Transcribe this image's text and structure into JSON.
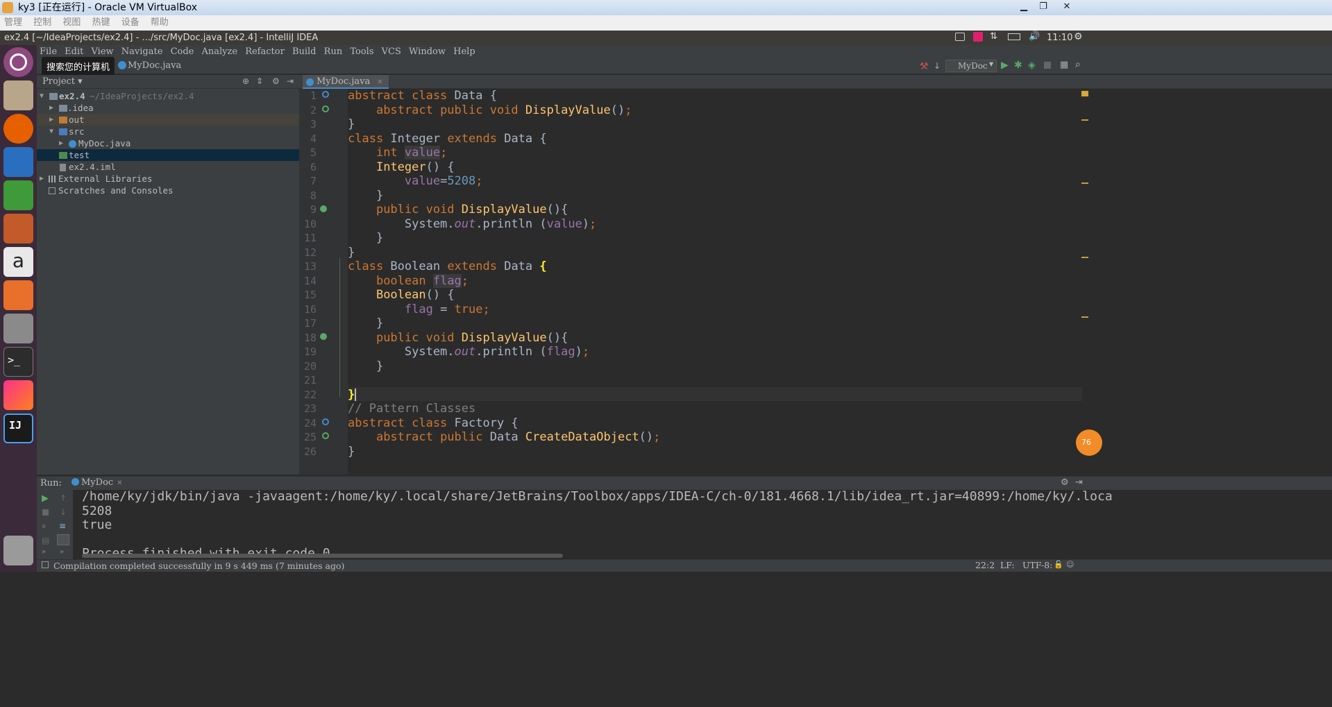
{
  "vbox": {
    "title": "ky3 [正在运行] - Oracle VM VirtualBox",
    "minimize": "▁",
    "restore": "❐",
    "close": "✕"
  },
  "vbox_menu": [
    "管理",
    "控制",
    "视图",
    "热键",
    "设备",
    "帮助"
  ],
  "ubuntu_bar": {
    "window_title": "ex2.4 [~/IdeaProjects/ex2.4] - .../src/MyDoc.java [ex2.4] - IntelliJ IDEA",
    "time": "11:10"
  },
  "launcher_tooltip": "搜索您的计算机",
  "ide_menu": [
    "File",
    "Edit",
    "View",
    "Navigate",
    "Code",
    "Analyze",
    "Refactor",
    "Build",
    "Run",
    "Tools",
    "VCS",
    "Window",
    "Help"
  ],
  "breadcrumb": "MyDoc.java",
  "run_config": "MyDoc",
  "project_panel": {
    "title": "Project"
  },
  "tree": [
    {
      "label": "ex2.4",
      "path": "~/IdeaProjects/ex2.4"
    },
    {
      "label": ".idea"
    },
    {
      "label": "out"
    },
    {
      "label": "src"
    },
    {
      "label": "MyDoc.java"
    },
    {
      "label": "test"
    },
    {
      "label": "ex2.4.iml"
    },
    {
      "label": "External Libraries"
    },
    {
      "label": "Scratches and Consoles"
    }
  ],
  "editor_tab": "MyDoc.java",
  "line_numbers": [
    "1",
    "2",
    "3",
    "4",
    "5",
    "6",
    "7",
    "8",
    "9",
    "10",
    "11",
    "12",
    "13",
    "14",
    "15",
    "16",
    "17",
    "18",
    "19",
    "20",
    "21",
    "22",
    "23",
    "24",
    "25",
    "26"
  ],
  "code": {
    "comment_line": "// Pattern Classes"
  },
  "run_panel": {
    "label": "Run:",
    "tab": "MyDoc"
  },
  "console_lines": [
    "/home/ky/jdk/bin/java -javaagent:/home/ky/.local/share/JetBrains/Toolbox/apps/IDEA-C/ch-0/181.4668.1/lib/idea_rt.jar=40899:/home/ky/.loca",
    "5208",
    "true",
    "",
    "Process finished with exit code 0"
  ],
  "status_bar": {
    "message": "Compilation completed successfully in 9 s 449 ms (7 minutes ago)",
    "position": "22:2",
    "line_sep": "LF:",
    "encoding": "UTF-8:"
  },
  "badge": "76",
  "colors": {
    "keyword": "#cc7832",
    "function": "#ffc66d",
    "field": "#9876aa",
    "number": "#6897bb",
    "comment": "#808080"
  }
}
